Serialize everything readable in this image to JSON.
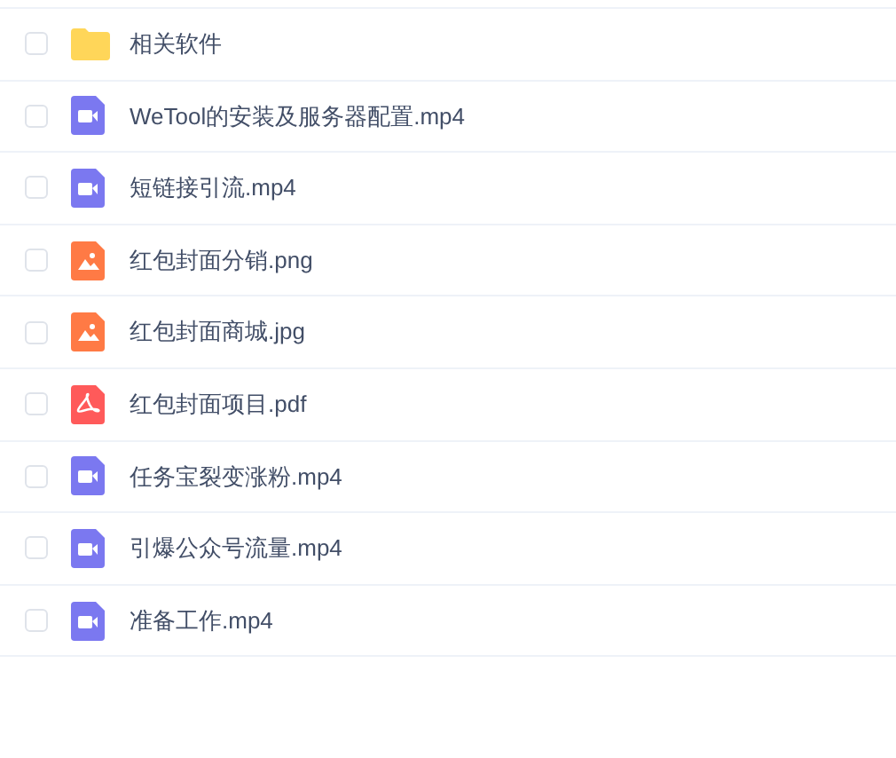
{
  "files": [
    {
      "name": "相关软件",
      "kind": "folder",
      "checked": false
    },
    {
      "name": "WeTool的安装及服务器配置.mp4",
      "kind": "video",
      "checked": false
    },
    {
      "name": "短链接引流.mp4",
      "kind": "video",
      "checked": false
    },
    {
      "name": "红包封面分销.png",
      "kind": "image",
      "checked": false
    },
    {
      "name": "红包封面商城.jpg",
      "kind": "image",
      "checked": false
    },
    {
      "name": "红包封面项目.pdf",
      "kind": "pdf",
      "checked": false
    },
    {
      "name": "任务宝裂变涨粉.mp4",
      "kind": "video",
      "checked": false
    },
    {
      "name": "引爆公众号流量.mp4",
      "kind": "video",
      "checked": false
    },
    {
      "name": "准备工作.mp4",
      "kind": "video",
      "checked": false
    }
  ]
}
